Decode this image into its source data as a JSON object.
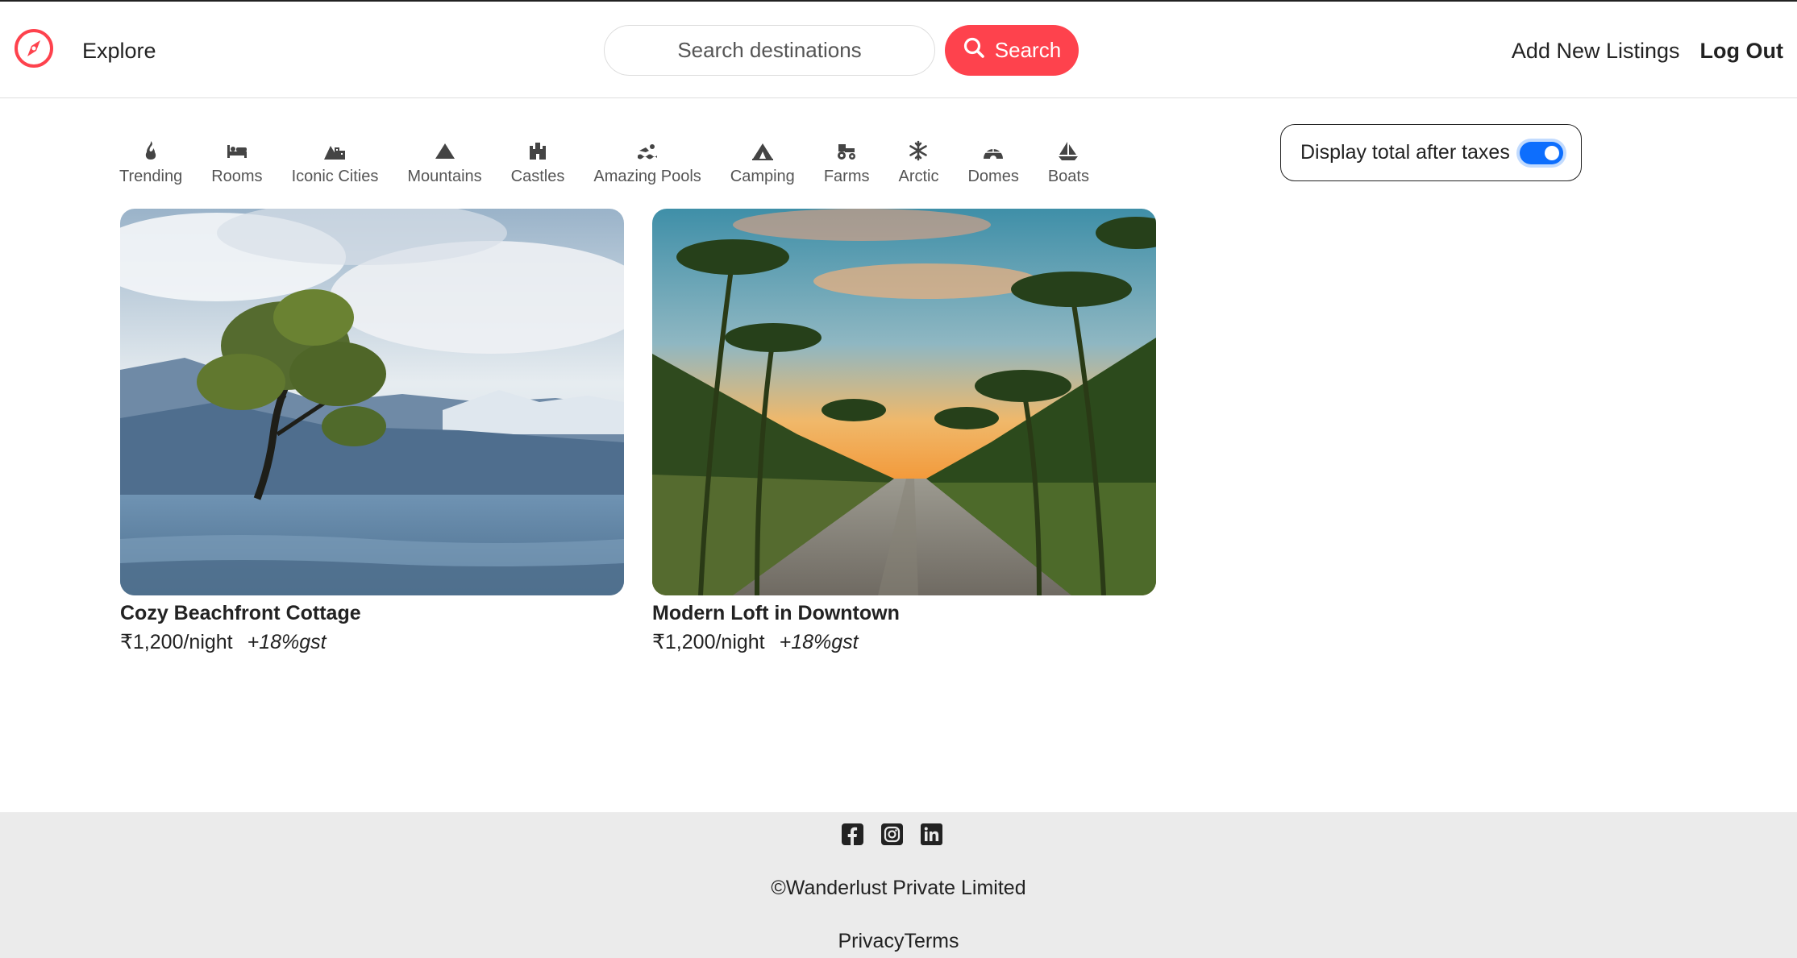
{
  "brand": {
    "icon": "compass-icon",
    "color": "#fe424d"
  },
  "nav": {
    "explore": "Explore",
    "search_placeholder": "Search destinations",
    "search_button": "Search",
    "add_listing": "Add New Listings",
    "logout": "Log Out"
  },
  "filters": [
    {
      "label": "Trending",
      "icon": "fire-icon"
    },
    {
      "label": "Rooms",
      "icon": "bed-icon"
    },
    {
      "label": "Iconic Cities",
      "icon": "mountain-city-icon"
    },
    {
      "label": "Mountains",
      "icon": "mountain-icon"
    },
    {
      "label": "Castles",
      "icon": "castle-icon"
    },
    {
      "label": "Amazing Pools",
      "icon": "person-swimming-icon"
    },
    {
      "label": "Camping",
      "icon": "campground-icon"
    },
    {
      "label": "Farms",
      "icon": "tractor-icon"
    },
    {
      "label": "Arctic",
      "icon": "snowflake-icon"
    },
    {
      "label": "Domes",
      "icon": "igloo-icon"
    },
    {
      "label": "Boats",
      "icon": "sailboat-icon"
    }
  ],
  "tax_toggle": {
    "label": "Display total after taxes",
    "checked": true,
    "accent": "#0d6efd"
  },
  "listings": [
    {
      "title": "Cozy Beachfront Cottage",
      "price": "₹1,200/night",
      "gst": "+18%gst",
      "image": "tree-in-lake-photo"
    },
    {
      "title": "Modern Loft in Downtown",
      "price": "₹1,200/night",
      "gst": "+18%gst",
      "image": "palm-road-sunset-photo"
    }
  ],
  "footer": {
    "socials": [
      "facebook-icon",
      "instagram-icon",
      "linkedin-icon"
    ],
    "copyright": "©Wanderlust Private Limited",
    "privacy": "Privacy",
    "terms": "Terms"
  }
}
